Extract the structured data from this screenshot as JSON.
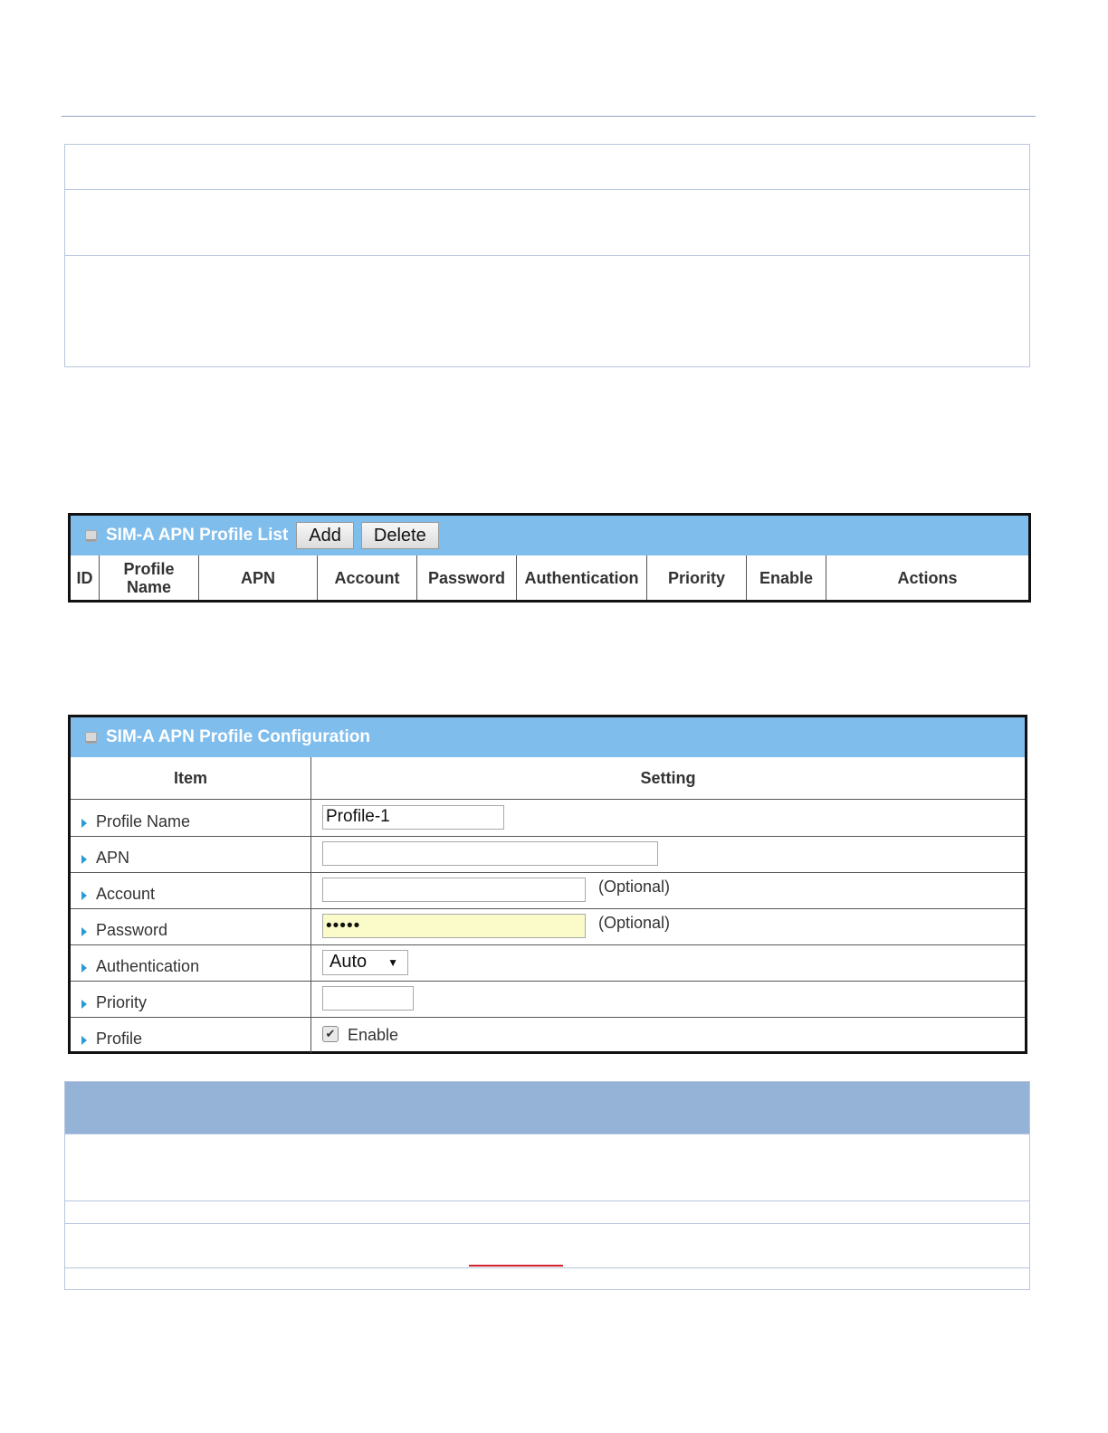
{
  "list_panel": {
    "title": "SIM-A APN Profile List",
    "buttons": {
      "add": "Add",
      "delete": "Delete"
    },
    "columns": [
      "ID",
      "Profile Name",
      "APN",
      "Account",
      "Password",
      "Authentication",
      "Priority",
      "Enable",
      "Actions"
    ]
  },
  "config_panel": {
    "title": "SIM-A APN Profile Configuration",
    "header": {
      "item": "Item",
      "setting": "Setting"
    },
    "rows": {
      "profile_name": {
        "label": "Profile Name",
        "value": "Profile-1"
      },
      "apn": {
        "label": "APN",
        "value": ""
      },
      "account": {
        "label": "Account",
        "value": "",
        "note": "(Optional)"
      },
      "password": {
        "label": "Password",
        "value": "•••••",
        "note": "(Optional)"
      },
      "authentication": {
        "label": "Authentication",
        "selected": "Auto"
      },
      "priority": {
        "label": "Priority",
        "value": ""
      },
      "profile": {
        "label": "Profile",
        "checkbox_label": "Enable",
        "checked": true
      }
    }
  },
  "colors": {
    "panel_header": "#7fbdec",
    "doc_header": "#95b3d7",
    "password_bg": "#fafbc8",
    "link_red": "#d0202a"
  }
}
